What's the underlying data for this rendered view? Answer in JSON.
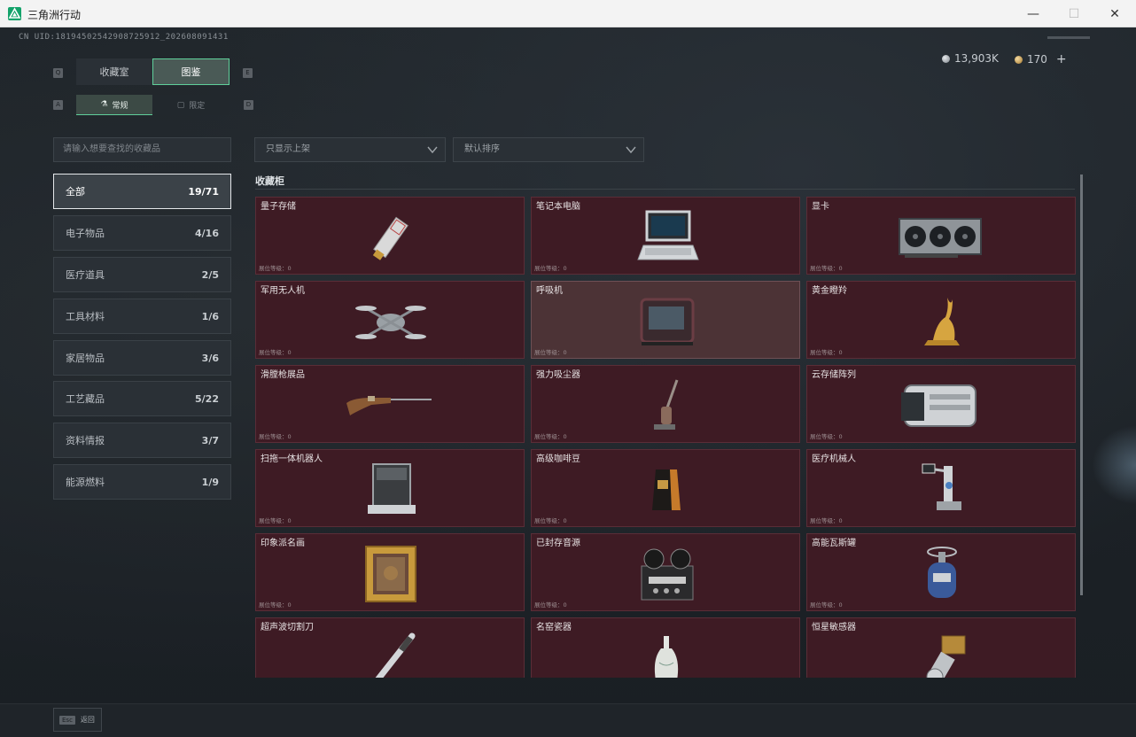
{
  "window": {
    "title": "三角洲行动",
    "min_glyph": "—",
    "max_glyph": "☐",
    "close_glyph": "✕"
  },
  "header": {
    "uid": "CN UID:18194502542908725912_202608091431",
    "currency": [
      {
        "icon": "silver-coin-icon",
        "value": "13,903K"
      },
      {
        "icon": "gold-coin-icon",
        "value": "170"
      }
    ],
    "add_glyph": "+"
  },
  "tabs": {
    "left_key": "Q",
    "right_key": "E",
    "items": [
      {
        "label": "收藏室",
        "active": false
      },
      {
        "label": "图鉴",
        "active": true
      }
    ]
  },
  "subtabs": {
    "left_key": "A",
    "right_key": "D",
    "items": [
      {
        "label": "常规",
        "icon": "flask-icon",
        "active": true
      },
      {
        "label": "限定",
        "icon": "frame-icon",
        "active": false
      }
    ]
  },
  "filters": {
    "search_placeholder": "请输入想要查找的收藏品",
    "display_filter": "只显示上架",
    "sort": "默认排序"
  },
  "categories": [
    {
      "label": "全部",
      "count": "19/71",
      "active": true
    },
    {
      "label": "电子物品",
      "count": "4/16",
      "active": false
    },
    {
      "label": "医疗道具",
      "count": "2/5",
      "active": false
    },
    {
      "label": "工具材料",
      "count": "1/6",
      "active": false
    },
    {
      "label": "家居物品",
      "count": "3/6",
      "active": false
    },
    {
      "label": "工艺藏品",
      "count": "5/22",
      "active": false
    },
    {
      "label": "资料情报",
      "count": "3/7",
      "active": false
    },
    {
      "label": "能源燃料",
      "count": "1/9",
      "active": false
    }
  ],
  "cabinet": {
    "title": "收藏柜",
    "level_label": "展位等级：0",
    "items": [
      {
        "name": "量子存储",
        "icon": "quantum-storage-icon"
      },
      {
        "name": "笔记本电脑",
        "icon": "laptop-icon"
      },
      {
        "name": "显卡",
        "icon": "graphics-card-icon"
      },
      {
        "name": "军用无人机",
        "icon": "drone-icon"
      },
      {
        "name": "呼吸机",
        "icon": "ventilator-icon"
      },
      {
        "name": "黄金瞪羚",
        "icon": "golden-gazelle-icon"
      },
      {
        "name": "滑膛枪展品",
        "icon": "musket-icon"
      },
      {
        "name": "强力吸尘器",
        "icon": "vacuum-cleaner-icon"
      },
      {
        "name": "云存储阵列",
        "icon": "storage-array-icon"
      },
      {
        "name": "扫拖一体机器人",
        "icon": "mop-robot-icon"
      },
      {
        "name": "高级咖啡豆",
        "icon": "coffee-bag-icon"
      },
      {
        "name": "医疗机械人",
        "icon": "medical-robot-icon"
      },
      {
        "name": "印象派名画",
        "icon": "painting-icon"
      },
      {
        "name": "已封存音源",
        "icon": "reel-recorder-icon"
      },
      {
        "name": "高能瓦斯罐",
        "icon": "gas-canister-icon"
      },
      {
        "name": "超声波切割刀",
        "icon": "ultrasonic-knife-icon"
      },
      {
        "name": "名窑瓷器",
        "icon": "porcelain-vase-icon"
      },
      {
        "name": "恒星敏感器",
        "icon": "star-sensor-icon"
      }
    ]
  },
  "footer": {
    "esc_key": "Esc",
    "esc_label": "返回"
  },
  "colors": {
    "accent": "#5fcf9a",
    "card_bg": "#3e1b24",
    "card_hover_bg": "#4c3336"
  }
}
